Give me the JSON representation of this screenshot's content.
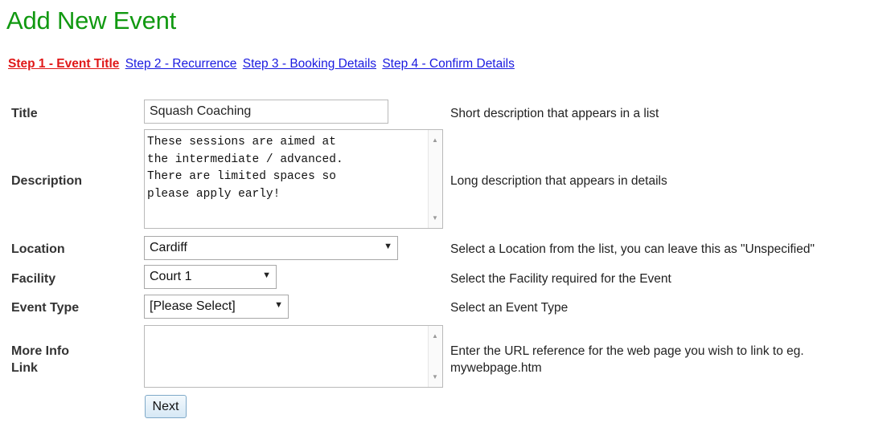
{
  "page": {
    "title": "Add New Event"
  },
  "steps": [
    {
      "label": "Step 1 - Event Title",
      "active": true
    },
    {
      "label": "Step 2 - Recurrence",
      "active": false
    },
    {
      "label": "Step 3 - Booking Details",
      "active": false
    },
    {
      "label": "Step 4 - Confirm Details",
      "active": false
    }
  ],
  "form": {
    "title": {
      "label": "Title",
      "value": "Squash Coaching",
      "help": "Short description that appears in a list"
    },
    "description": {
      "label": "Description",
      "value": "These sessions are aimed at\nthe intermediate / advanced.\nThere are limited spaces so\nplease apply early!",
      "help": "Long description that appears in details"
    },
    "location": {
      "label": "Location",
      "value": "Cardiff",
      "help": "Select a Location from the list, you can leave this as \"Unspecified\""
    },
    "facility": {
      "label": "Facility",
      "value": "Court 1",
      "help": "Select the Facility required for the Event"
    },
    "event_type": {
      "label": "Event Type",
      "value": "[Please Select]",
      "help": "Select an Event Type"
    },
    "more_info": {
      "label_line1": "More Info",
      "label_line2": "Link",
      "value": "",
      "help_line1": "Enter the URL reference for the web page you wish to link to eg.",
      "help_line2": "mywebpage.htm"
    },
    "next_label": "Next"
  }
}
